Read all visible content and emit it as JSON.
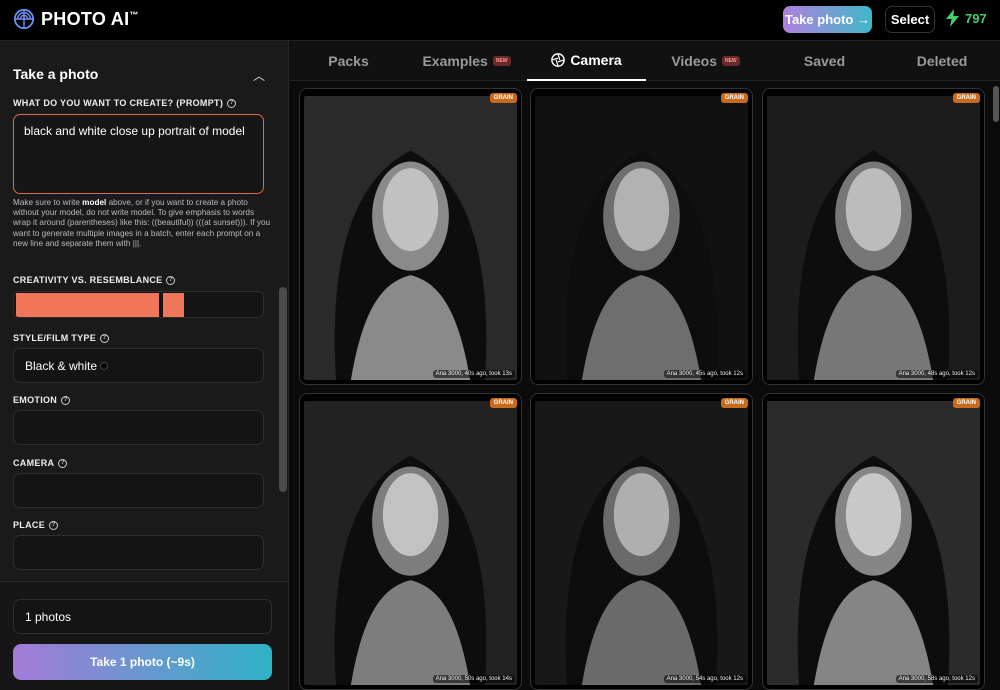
{
  "header": {
    "logo": "PHOTO AI",
    "tm": "™",
    "take_photo_label": "Take photo →",
    "select_label": "Select",
    "credits": "797"
  },
  "sidebar": {
    "section_title": "Take a photo",
    "prompt_label": "WHAT DO YOU WANT TO CREATE? (PROMPT)",
    "prompt_value": "black and white close up portrait of model",
    "help_pre": "Make sure to write ",
    "help_bold": "model",
    "help_post": " above, or if you want to create a photo without your model, do not write model. To give emphasis to words wrap it around (parentheses) like this: ((beautiful)) (((at sunset))). If you want to generate multiple images in a batch, enter each prompt on a new line and separate them with |||.",
    "creativity_label": "CREATIVITY VS. RESEMBLANCE",
    "creativity_value": 0.65,
    "style_label": "STYLE/FILM TYPE",
    "style_value": "Black & white",
    "emotion_label": "EMOTION",
    "emotion_value": "",
    "camera_label": "CAMERA",
    "camera_value": "",
    "place_label": "PLACE",
    "place_value": "",
    "photo_count": "1 photos",
    "take_button": "Take 1 photo (~9s)"
  },
  "tabs": [
    {
      "label": "Packs",
      "new": ""
    },
    {
      "label": "Examples",
      "new": "NEW"
    },
    {
      "label": "Camera",
      "new": ""
    },
    {
      "label": "Videos",
      "new": "NEW"
    },
    {
      "label": "Saved",
      "new": ""
    },
    {
      "label": "Deleted",
      "new": ""
    }
  ],
  "active_tab": "Camera",
  "photos": [
    {
      "badge": "GRAIN",
      "meta": "Ana 3000, 40s ago, took 13s"
    },
    {
      "badge": "GRAIN",
      "meta": "Ana 3000, 45s ago, took 12s"
    },
    {
      "badge": "GRAIN",
      "meta": "Ana 3000, 48s ago, took 12s"
    },
    {
      "badge": "GRAIN",
      "meta": "Ana 3000, 50s ago, took 14s"
    },
    {
      "badge": "GRAIN",
      "meta": "Ana 3000, 54s ago, took 12s"
    },
    {
      "badge": "GRAIN",
      "meta": "Ana 3000, 58s ago, took 12s"
    }
  ],
  "colors": {
    "accent": "#f0765a",
    "credit_green": "#44d06a",
    "gradient_start": "#a47ad8",
    "gradient_end": "#2fb3c6",
    "badge": "#c86b1c"
  }
}
